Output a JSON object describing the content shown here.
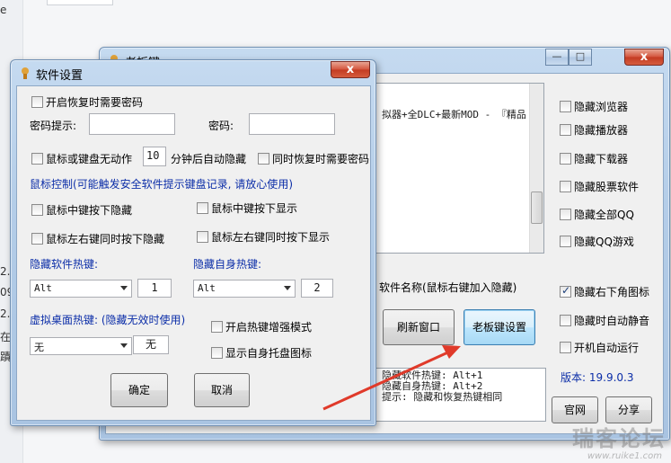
{
  "background": {
    "left_chars": [
      "e",
      "2.",
      "09",
      "2.1",
      "在",
      "蹟"
    ]
  },
  "main_window": {
    "title": "老板键",
    "list_text": "拟器+全DLC+最新MOD - 『精品",
    "options": [
      {
        "label": "隐藏浏览器",
        "checked": false
      },
      {
        "label": "隐藏播放器",
        "checked": false
      },
      {
        "label": "隐藏下载器",
        "checked": false
      },
      {
        "label": "隐藏股票软件",
        "checked": false
      },
      {
        "label": "隐藏全部QQ",
        "checked": false
      },
      {
        "label": "隐藏QQ游戏",
        "checked": false
      }
    ],
    "software_name_label": "软件名称(鼠标右键加入隐藏)",
    "refresh_button": "刷新窗口",
    "settings_button": "老板键设置",
    "right_options": [
      {
        "label": "隐藏右下角图标",
        "checked": true
      },
      {
        "label": "隐藏时自动静音",
        "checked": false
      },
      {
        "label": "开机自动运行",
        "checked": false
      }
    ],
    "info_lines": [
      "隐藏软件热键: Alt+1",
      "隐藏自身热键: Alt+2",
      "提示: 隐藏和恢复热键相同"
    ],
    "version_label": "版本: 19.9.0.3",
    "website_button": "官网",
    "share_button": "分享"
  },
  "settings_dialog": {
    "title": "软件设置",
    "close_label": "x",
    "require_password_label": "开启恢复时需要密码",
    "password_hint_label": "密码提示:",
    "password_hint_value": "",
    "password_label": "密码:",
    "password_value": "",
    "idle_label": "鼠标或键盘无动作",
    "idle_minutes": "10",
    "idle_suffix": "分钟后自动隐藏",
    "also_password_label": "同时恢复时需要密码",
    "mouse_section_label": "鼠标控制(可能触发安全软件提示键盘记录, 请放心使用)",
    "mouse_options": [
      "鼠标中键按下隐藏",
      "鼠标中键按下显示",
      "鼠标左右键同时按下隐藏",
      "鼠标左右键同时按下显示"
    ],
    "hide_software_hotkey_label": "隐藏软件热键:",
    "hide_software_mod": "Alt",
    "hide_software_key": "1",
    "hide_self_hotkey_label": "隐藏自身热键:",
    "hide_self_mod": "Alt",
    "hide_self_key": "2",
    "virtual_desktop_label": "虚拟桌面热键: (隐藏无效时使用)",
    "virtual_desktop_mod": "无",
    "virtual_desktop_key": "无",
    "enhanced_hotkey_label": "开启热键增强模式",
    "tray_icon_label": "显示自身托盘图标",
    "ok_button": "确定",
    "cancel_button": "取消"
  },
  "watermark": {
    "text": "瑞客论坛",
    "url": "www.ruike1.com"
  }
}
